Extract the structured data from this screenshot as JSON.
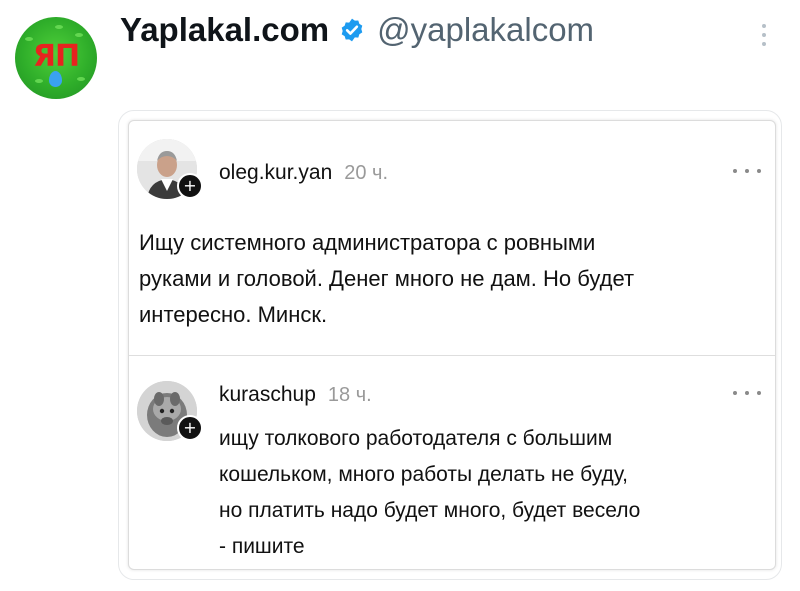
{
  "tweet": {
    "avatar_logo_text": "ЯП",
    "display_name": "Yaplakal.com",
    "handle": "@yaplakalcom",
    "verified_badge_color": "#1d9bf0"
  },
  "thread": {
    "posts": [
      {
        "username": "oleg.kur.yan",
        "time": "20 ч.",
        "lines": [
          "Ищу системного администратора с ровными",
          "руками и головой. Денег много не дам. Но будет",
          "интересно. Минск."
        ]
      },
      {
        "username": "kuraschup",
        "time": "18 ч.",
        "lines": [
          "ищу толкового работодателя с большим",
          "кошельком, много работы делать не буду,",
          "но платить надо будет много, будет весело",
          "- пишите"
        ]
      }
    ],
    "follow_badge": "+"
  },
  "icons": {
    "verified": "verified-badge-icon",
    "more": "more-vertical-icon",
    "post_more": "more-horizontal-icon",
    "follow": "plus-icon"
  }
}
